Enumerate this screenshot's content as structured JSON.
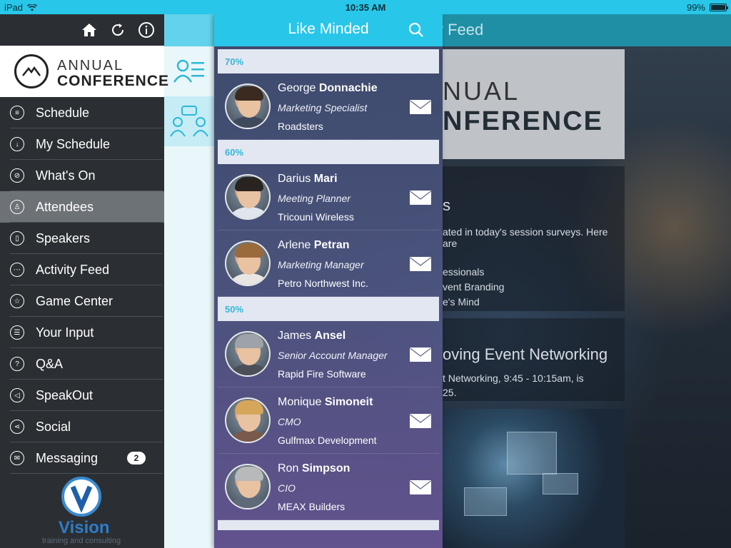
{
  "status_bar": {
    "device": "iPad",
    "time": "10:35 AM",
    "battery": "99%",
    "battery_level": 0.99
  },
  "menu": {
    "logo": {
      "line1": "ANNUAL",
      "line2": "CONFERENCE"
    },
    "items": [
      {
        "label": "Schedule",
        "icon": "list-icon"
      },
      {
        "label": "My Schedule",
        "icon": "download-icon"
      },
      {
        "label": "What's On",
        "icon": "compass-icon"
      },
      {
        "label": "Attendees",
        "icon": "person-icon"
      },
      {
        "label": "Speakers",
        "icon": "badge-icon"
      },
      {
        "label": "Activity Feed",
        "icon": "chat-icon"
      },
      {
        "label": "Game Center",
        "icon": "star-icon"
      },
      {
        "label": "Your Input",
        "icon": "checklist-icon"
      },
      {
        "label": "Q&A",
        "icon": "question-icon"
      },
      {
        "label": "SpeakOut",
        "icon": "megaphone-icon"
      },
      {
        "label": "Social",
        "icon": "share-icon"
      },
      {
        "label": "Messaging",
        "icon": "envelope-icon",
        "badge": "2"
      }
    ],
    "active_item": "Attendees",
    "sponsor": {
      "name": "Vision",
      "tagline": "training and consulting"
    }
  },
  "background": {
    "header_title": "y Feed",
    "banner": {
      "line1": "NUAL",
      "line2": "NFERENCE"
    },
    "card1": {
      "title": "s",
      "lines": [
        "ated in today's session surveys. Here are",
        "essionals",
        "vent Branding",
        "e's Mind"
      ]
    },
    "card2": {
      "title": "oving Event Networking",
      "lines": [
        "t Networking, 9:45 - 10:15am, is",
        "25."
      ]
    }
  },
  "panel": {
    "title": "Like Minded",
    "groups": [
      {
        "label": "70%",
        "people": [
          {
            "first": "George",
            "last": "Donnachie",
            "role": "Marketing Specialist",
            "company": "Roadsters"
          }
        ]
      },
      {
        "label": "60%",
        "people": [
          {
            "first": "Darius",
            "last": "Mari",
            "role": "Meeting Planner",
            "company": "Tricouni Wireless"
          },
          {
            "first": "Arlene",
            "last": "Petran",
            "role": "Marketing Manager",
            "company": "Petro Northwest Inc."
          }
        ]
      },
      {
        "label": "50%",
        "people": [
          {
            "first": "James",
            "last": "Ansel",
            "role": "Senior Account Manager",
            "company": "Rapid Fire Software"
          },
          {
            "first": "Monique",
            "last": "Simoneit",
            "role": "CMO",
            "company": "Gulfmax Development"
          },
          {
            "first": "Ron",
            "last": "Simpson",
            "role": "CIO",
            "company": "MEAX Builders"
          }
        ]
      }
    ]
  },
  "colors": {
    "accent": "#28c6e8",
    "menu_bg": "#2b2f33",
    "menu_active": "#6d7277",
    "group_label": "#31b7d7"
  }
}
